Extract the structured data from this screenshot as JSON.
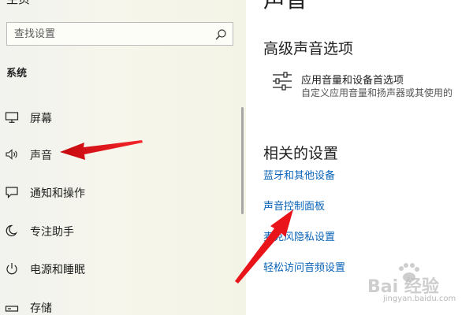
{
  "sidebar": {
    "top_clipped": "主页",
    "search": {
      "placeholder": "查找设置",
      "icon": "search-icon"
    },
    "section_label": "系统",
    "items": [
      {
        "label": "屏幕",
        "icon": "display-icon"
      },
      {
        "label": "声音",
        "icon": "speaker-icon"
      },
      {
        "label": "通知和操作",
        "icon": "notification-icon"
      },
      {
        "label": "专注助手",
        "icon": "moon-icon"
      },
      {
        "label": "电源和睡眠",
        "icon": "power-icon"
      },
      {
        "label": "存储",
        "icon": "storage-icon"
      }
    ]
  },
  "main": {
    "page_title": "声音",
    "advanced": {
      "heading": "高级声音选项",
      "app_volume": {
        "title": "应用音量和设备首选项",
        "description": "自定义应用音量和扬声器或其使用的"
      }
    },
    "related": {
      "heading": "相关的设置",
      "links": [
        "蓝牙和其他设备",
        "声音控制面板",
        "麦克风隐私设置",
        "轻松访问音频设置"
      ]
    }
  },
  "watermark": {
    "text": "Bai 经验",
    "url": "jingyan.baidu.com"
  },
  "colors": {
    "link": "#0a63b8",
    "annotation_arrow": "#e8141a",
    "sidebar_bg": "#f4f4ea"
  }
}
